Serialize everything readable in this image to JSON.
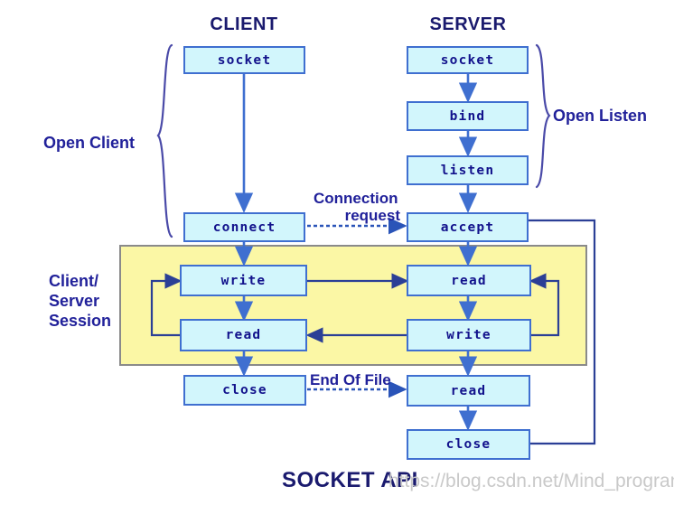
{
  "diagram": {
    "title": "SOCKET API",
    "watermark": "https://blog.csdn.net/Mind_programmonkey",
    "columns": {
      "client": "CLIENT",
      "server": "SERVER"
    },
    "group_labels": {
      "open_client": "Open Client",
      "open_listen": "Open Listen",
      "session_line1": "Client/",
      "session_line2": "Server",
      "session_line3": "Session"
    },
    "edge_labels": {
      "connection_line1": "Connection",
      "connection_line2": "request",
      "end_of_file": "End Of File"
    },
    "client_nodes": [
      {
        "id": "client-socket",
        "label": "socket"
      },
      {
        "id": "client-connect",
        "label": "connect"
      },
      {
        "id": "client-write",
        "label": "write"
      },
      {
        "id": "client-read",
        "label": "read"
      },
      {
        "id": "client-close",
        "label": "close"
      }
    ],
    "server_nodes": [
      {
        "id": "server-socket",
        "label": "socket"
      },
      {
        "id": "server-bind",
        "label": "bind"
      },
      {
        "id": "server-listen",
        "label": "listen"
      },
      {
        "id": "server-accept",
        "label": "accept"
      },
      {
        "id": "server-read-session",
        "label": "read"
      },
      {
        "id": "server-write-session",
        "label": "write"
      },
      {
        "id": "server-read-eof",
        "label": "read"
      },
      {
        "id": "server-close",
        "label": "close"
      }
    ],
    "colors": {
      "box_fill": "#d2f6fc",
      "box_border": "#3f6fd0",
      "session_fill": "#fbf7a5",
      "session_border": "#8a8a8a",
      "text_navy": "#12128c",
      "label_blue": "#21219a",
      "arrow_blue": "#3f6fd0",
      "watermark_gray": "#c9c9c9"
    }
  }
}
